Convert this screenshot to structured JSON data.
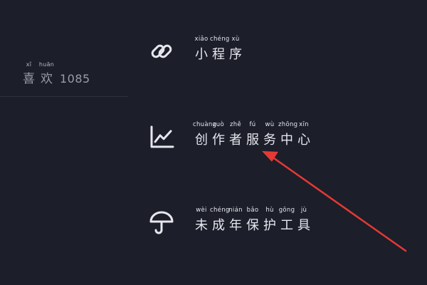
{
  "likes": {
    "pinyin": [
      "xǐ",
      "huān"
    ],
    "chars": [
      "喜",
      "欢"
    ],
    "count": "1085"
  },
  "menu": [
    {
      "icon": "link-icon",
      "pinyin": [
        "xiǎo",
        "chéng",
        "xù"
      ],
      "chars": [
        "小",
        "程",
        "序"
      ]
    },
    {
      "icon": "chart-icon",
      "pinyin": [
        "chuàng",
        "zuò",
        "zhě",
        "fú",
        "wù",
        "zhōng",
        "xīn"
      ],
      "chars": [
        "创",
        "作",
        "者",
        "服",
        "务",
        "中",
        "心"
      ]
    },
    {
      "icon": "umbrella-icon",
      "pinyin": [
        "wèi",
        "chéng",
        "nián",
        "bǎo",
        "hù",
        "gōng",
        "jù"
      ],
      "chars": [
        "未",
        "成",
        "年",
        "保",
        "护",
        "工",
        "具"
      ]
    }
  ],
  "colors": {
    "background": "#1c1e29",
    "text": "#e6e6ee",
    "muted": "#9a9ba6",
    "arrow": "#e53935"
  }
}
